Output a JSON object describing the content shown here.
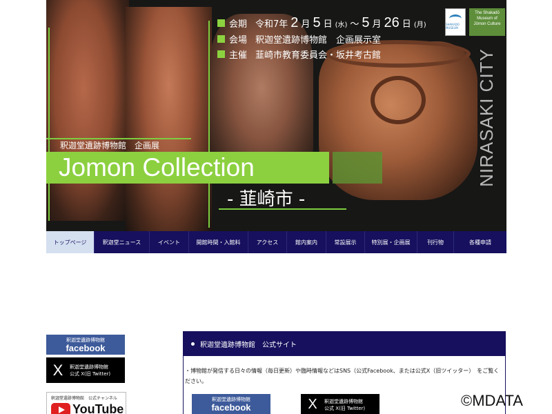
{
  "banner": {
    "event": {
      "period_label": "会期",
      "era": "令和7年",
      "start_month": "2",
      "start_month_unit": "月",
      "start_day": "5",
      "start_day_unit": "日",
      "start_dow": "(水)",
      "tilde": "～",
      "end_month": "5",
      "end_month_unit": "月",
      "end_day": "26",
      "end_day_unit": "日",
      "end_dow": "(月)",
      "venue_label": "会場",
      "venue_value": "釈迦堂遺跡博物館　企画展示室",
      "host_label": "主催",
      "host_value": "韮崎市教育委員会・坂井考古館"
    },
    "logo_caption": "SHAKADO MUSEUM",
    "museum_box": [
      "The Shakadō",
      "Museum of",
      "Jōmon Culture"
    ],
    "city_vertical": "NIRASAKI CITY",
    "subtitle": "釈迦堂遺跡博物館　企画展",
    "title": "Jomon Collection",
    "city_jp": "- 韮崎市 -",
    "colors": {
      "accent_green": "#8cd040",
      "nav_navy": "#16105e"
    }
  },
  "nav": {
    "items": [
      {
        "label": "トップページ",
        "active": true
      },
      {
        "label": "釈迦堂ニュース"
      },
      {
        "label": "イベント"
      },
      {
        "label": "開館時間・入館料"
      },
      {
        "label": "アクセス"
      },
      {
        "label": "館内案内"
      },
      {
        "label": "常設展示"
      },
      {
        "label": "特別展・企画展"
      },
      {
        "label": "刊行物"
      },
      {
        "label": "各種申請"
      }
    ]
  },
  "sidebar": {
    "facebook": {
      "small": "釈迦堂遺跡博物館",
      "big": "facebook"
    },
    "x": {
      "logo": "X",
      "line1": "釈迦堂遺跡博物館",
      "line2": "公式 X(旧 Twitter)"
    },
    "youtube": {
      "small": "釈迦堂遺跡博物館　公式チャンネル",
      "big": "YouTube"
    }
  },
  "panel": {
    "title": "釈迦堂遺跡博物館　公式サイト",
    "body": "・博物館が発信する日々の情報（毎日更新）や臨時情報などはSNS（公式Facebook、または公式X（旧ツイッター）　をご覧ください。",
    "facebook": {
      "small": "釈迦堂遺跡博物館",
      "big": "facebook"
    },
    "x": {
      "logo": "X",
      "line1": "釈迦堂遺跡博物館",
      "line2": "公式 X(旧 Twitter)"
    }
  },
  "watermark": "©MDATA"
}
